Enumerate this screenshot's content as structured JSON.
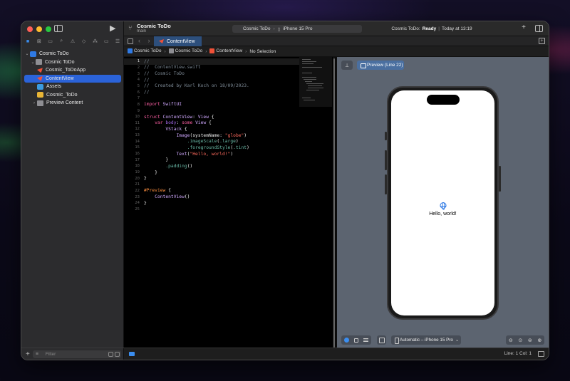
{
  "window": {
    "project_name": "Cosmic ToDo",
    "branch": "main"
  },
  "toolbar": {
    "scheme": "Cosmic ToDo",
    "device": "iPhone 15 Pro",
    "status_prefix": "Cosmic ToDo:",
    "status_state": "Ready",
    "status_time": "Today at 13:19"
  },
  "navigator": {
    "items": [
      {
        "label": "Cosmic ToDo",
        "kind": "project"
      },
      {
        "label": "Cosmic ToDo",
        "kind": "folder"
      },
      {
        "label": "Cosmic_ToDoApp",
        "kind": "swift"
      },
      {
        "label": "ContentView",
        "kind": "swift",
        "selected": true
      },
      {
        "label": "Assets",
        "kind": "assets"
      },
      {
        "label": "Cosmic_ToDo",
        "kind": "entitlements"
      },
      {
        "label": "Preview Content",
        "kind": "folder"
      }
    ],
    "filter_placeholder": "Filter"
  },
  "tab": {
    "active_label": "ContentView"
  },
  "jumpbar": {
    "crumbs": [
      "Cosmic ToDo",
      "Cosmic ToDo",
      "ContentView",
      "No Selection"
    ]
  },
  "code": {
    "lines": [
      "//",
      "//  ContentView.swift",
      "//  Cosmic ToDo",
      "//",
      "//  Created by Karl Koch on 18/09/2023.",
      "//",
      "",
      "import SwiftUI",
      "",
      "struct ContentView: View {",
      "    var body: some View {",
      "        VStack {",
      "            Image(systemName: \"globe\")",
      "                .imageScale(.large)",
      "                .foregroundStyle(.tint)",
      "            Text(\"Hello, world!\")",
      "        }",
      "        .padding()",
      "    }",
      "}",
      "",
      "#Preview {",
      "    ContentView()",
      "}",
      ""
    ],
    "current_line": 1
  },
  "canvas": {
    "preview_label": "Preview (Line 22)",
    "hello_text": "Hello, world!",
    "device_select": "Automatic – iPhone 15 Pro",
    "zoom_icons": [
      "zoom-out-icon",
      "zoom-fit-icon",
      "zoom-100-icon",
      "zoom-in-icon"
    ]
  },
  "statusbar": {
    "position": "Line: 1  Col: 1"
  },
  "colors": {
    "accent": "#2b63d9",
    "canvas_bg": "#5c6470",
    "editor_bg": "#000000"
  }
}
